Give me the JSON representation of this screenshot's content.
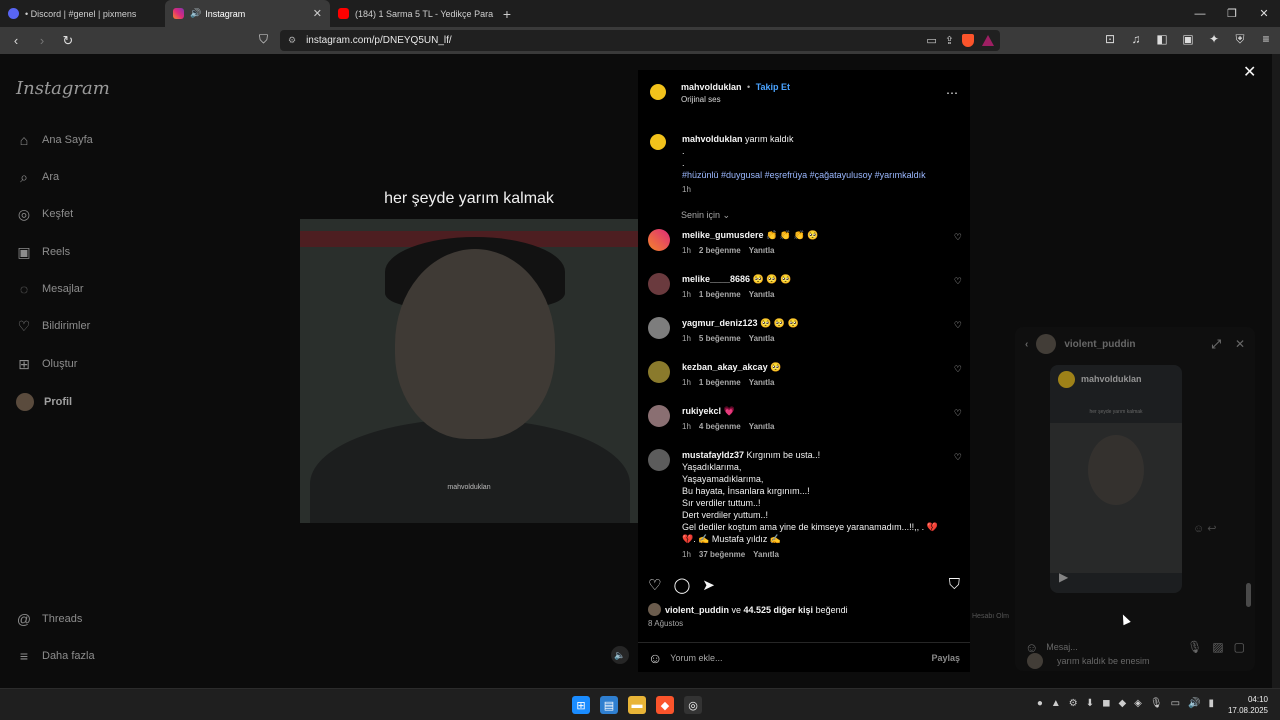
{
  "browser": {
    "tabs": [
      {
        "label": "• Discord | #genel | pixmens",
        "active": false
      },
      {
        "label": "Instagram",
        "active": true
      },
      {
        "label": "(184) 1 Sarma 5 TL - Yedikçe Para Ka",
        "active": false
      }
    ],
    "url": "instagram.com/p/DNEYQ5UN_lf/"
  },
  "sidebar": {
    "logo": "Instagram",
    "items": [
      {
        "label": "Ana Sayfa",
        "icon": "home-icon"
      },
      {
        "label": "Ara",
        "icon": "search-icon"
      },
      {
        "label": "Keşfet",
        "icon": "compass-icon"
      },
      {
        "label": "Reels",
        "icon": "reels-icon"
      },
      {
        "label": "Mesajlar",
        "icon": "messenger-icon"
      },
      {
        "label": "Bildirimler",
        "icon": "heart-icon"
      },
      {
        "label": "Oluştur",
        "icon": "plus-square-icon"
      },
      {
        "label": "Profil",
        "icon": "avatar"
      }
    ],
    "threads": "Threads",
    "more": "Daha fazla"
  },
  "video": {
    "caption": "her şeyde yarım kalmak",
    "watermark": "mahvolduklan"
  },
  "post": {
    "author": "mahvolduklan",
    "separator": "•",
    "follow": "Takip Et",
    "audio": "Orijinal ses",
    "caption_user": "mahvolduklan",
    "caption_text": "yarım kaldık",
    "caption_dot1": ".",
    "caption_dot2": ".",
    "hashtags": "#hüzünlü #duygusal #eşrefrüya #çağatayulusoy #yarımkaldık",
    "caption_time": "1h",
    "sort": "Senin için",
    "comments": [
      {
        "user": "melike_gumusdere",
        "text": "👏 👏 👏 🥺",
        "time": "1h",
        "likes": "2 beğenme",
        "reply": "Yanıtla"
      },
      {
        "user": "melike____8686",
        "text": "🥺 🥺 🥺",
        "time": "1h",
        "likes": "1 beğenme",
        "reply": "Yanıtla"
      },
      {
        "user": "yagmur_deniz123",
        "text": "🥺 🥺 🥺",
        "time": "1h",
        "likes": "5 beğenme",
        "reply": "Yanıtla"
      },
      {
        "user": "kezban_akay_akcay",
        "text": "🥺",
        "time": "1h",
        "likes": "1 beğenme",
        "reply": "Yanıtla"
      },
      {
        "user": "rukiyekcl",
        "text": "💗",
        "time": "1h",
        "likes": "4 beğenme",
        "reply": "Yanıtla"
      },
      {
        "user": "mustafayldz37",
        "text": "Kırgınım be usta..!",
        "time": "1h",
        "likes": "37 beğenme",
        "reply": "Yanıtla",
        "lines": [
          "Yaşadıklarıma,",
          "Yaşayamadıklarıma,",
          "Bu hayata, İnsanlara kırgınım...!",
          "Sır verdiler tuttum..!",
          "Dert verdiler yuttum..!",
          "Gel dediler koştum ama yine de kimseye yaranamadım...!!,, . 💔",
          "💔. ✍️ Mustafa yıldız ✍️"
        ]
      }
    ],
    "liked_by_user": "violent_puddin",
    "liked_by_rest": " ve ",
    "liked_by_count": "44.525 diğer kişi",
    "liked_by_suffix": " beğendi",
    "date": "8 Ağustos",
    "comment_placeholder": "Yorum ekle...",
    "share": "Paylaş"
  },
  "dm": {
    "user": "violent_puddin",
    "card_user": "mahvolduklan",
    "card_text": "her şeyde yarım kalmak",
    "message": "yarım kaldık be enesim",
    "input_placeholder": "Mesaj..."
  },
  "page_misc": {
    "hesap": "Hesabı Olm"
  },
  "taskbar": {
    "time": "04:10",
    "date": "17.08.2025"
  }
}
